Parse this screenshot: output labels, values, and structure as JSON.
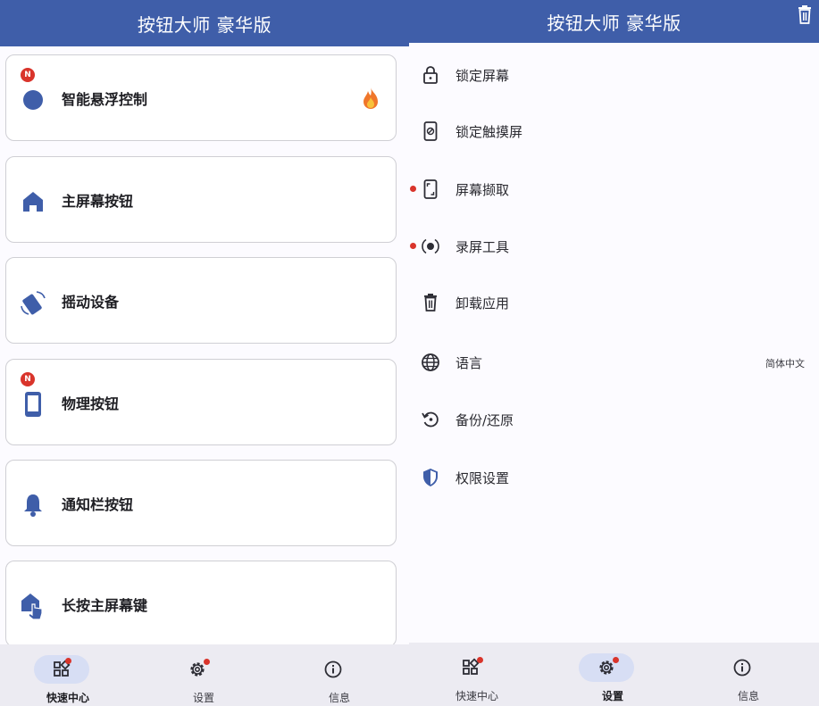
{
  "left": {
    "title": "按钮大师 豪华版",
    "cards": [
      {
        "label": "智能悬浮控制",
        "badge": "N",
        "icon": "floating-ball-icon",
        "extra_icon": "fire-icon"
      },
      {
        "label": "主屏幕按钮",
        "icon": "home-icon"
      },
      {
        "label": "摇动设备",
        "icon": "shake-device-icon"
      },
      {
        "label": "物理按钮",
        "badge": "N",
        "icon": "phone-icon"
      },
      {
        "label": "通知栏按钮",
        "icon": "bell-icon"
      },
      {
        "label": "长按主屏幕键",
        "icon": "home-touch-icon"
      }
    ],
    "nav": [
      {
        "label": "快速中心",
        "icon": "widgets-icon",
        "active": true,
        "dot": true
      },
      {
        "label": "设置",
        "icon": "gear-icon",
        "active": false,
        "dot": true
      },
      {
        "label": "信息",
        "icon": "info-icon",
        "active": false,
        "dot": false
      }
    ]
  },
  "right": {
    "title": "按钮大师 豪华版",
    "items": [
      {
        "label": "锁定屏幕",
        "icon": "lock-icon"
      },
      {
        "label": "锁定触摸屏",
        "icon": "touch-lock-icon"
      },
      {
        "label": "屏幕撷取",
        "icon": "screenshot-icon",
        "dot": true
      },
      {
        "label": "录屏工具",
        "icon": "record-icon",
        "dot": true
      },
      {
        "label": "卸载应用",
        "icon": "trash-icon"
      },
      {
        "label": "语言",
        "icon": "globe-icon",
        "value": "简体中文"
      },
      {
        "label": "备份/还原",
        "icon": "restore-icon"
      },
      {
        "label": "权限设置",
        "icon": "shield-icon"
      }
    ],
    "nav": [
      {
        "label": "快速中心",
        "icon": "widgets-icon",
        "active": false,
        "dot": true
      },
      {
        "label": "设置",
        "icon": "gear-icon",
        "active": true,
        "dot": true
      },
      {
        "label": "信息",
        "icon": "info-icon",
        "active": false,
        "dot": false
      }
    ]
  },
  "colors": {
    "primary": "#3f5ea9",
    "badge": "#d9342b",
    "nav_bg": "#ecebf2",
    "nav_active": "#d7def4"
  }
}
